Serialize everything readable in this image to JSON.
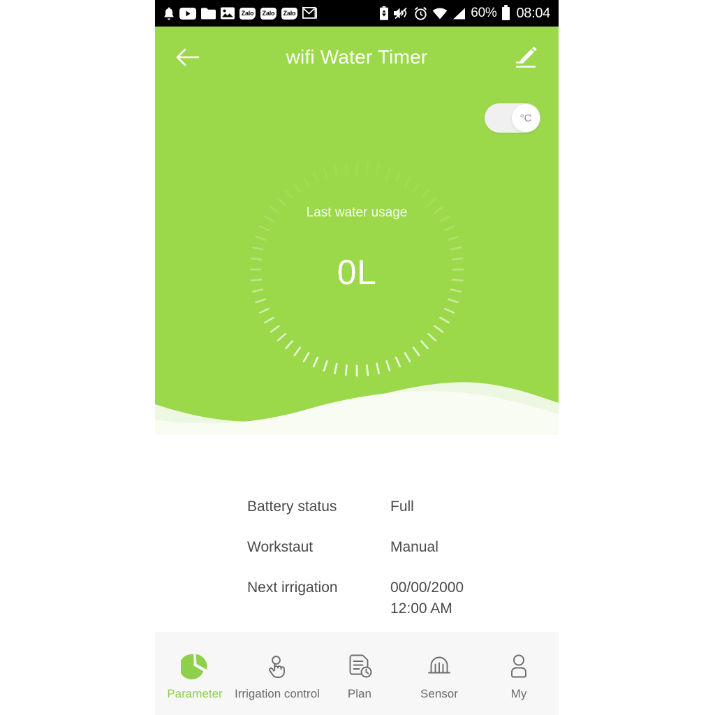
{
  "theme": {
    "green": "#9bd94b",
    "green_accent": "#8ed04a",
    "nav_bg": "#f7f7f7",
    "text_gray": "#4a4a4a",
    "nav_text": "#6b6b6b"
  },
  "status_bar": {
    "left_icons": [
      {
        "name": "notification-bell-icon",
        "glyph": "bell"
      },
      {
        "name": "youtube-icon",
        "glyph": "youtube"
      },
      {
        "name": "folder-icon",
        "glyph": "folder"
      },
      {
        "name": "image-icon",
        "glyph": "image"
      },
      {
        "name": "zalo-icon-1",
        "glyph": "zalo",
        "label": "Zalo"
      },
      {
        "name": "zalo-icon-2",
        "glyph": "zalo",
        "label": "Zalo"
      },
      {
        "name": "zalo-icon-3",
        "glyph": "zalo",
        "label": "Zalo"
      },
      {
        "name": "email-icon",
        "glyph": "envelope"
      }
    ],
    "right_icons": [
      {
        "name": "battery-saver-icon",
        "glyph": "battery-saver"
      },
      {
        "name": "mute-vibrate-icon",
        "glyph": "mute-vibrate"
      },
      {
        "name": "alarm-icon",
        "glyph": "alarm"
      },
      {
        "name": "wifi-icon",
        "glyph": "wifi"
      },
      {
        "name": "cellular-signal-icon",
        "glyph": "signal"
      }
    ],
    "battery_percent": "60%",
    "clock": "08:04"
  },
  "appbar": {
    "title": "wifi Water Timer",
    "back_icon": "arrow-left-icon",
    "edit_icon": "edit-pencil-icon"
  },
  "unit_toggle": {
    "value": "°C",
    "state": "on"
  },
  "dial": {
    "label": "Last water usage",
    "value": "0L",
    "tick_count": 60
  },
  "info": {
    "rows": [
      {
        "label": "Battery status",
        "value": "Full"
      },
      {
        "label": "Workstaut",
        "value": "Manual"
      },
      {
        "label": "Next  irrigation",
        "value": "00/00/2000\n12:00 AM"
      }
    ]
  },
  "bottom_nav": {
    "items": [
      {
        "label": "Parameter",
        "icon": "pie-chart-icon",
        "active": true
      },
      {
        "label": "Irrigation control",
        "icon": "tap-hand-icon",
        "active": false
      },
      {
        "label": "Plan",
        "icon": "document-clock-icon",
        "active": false
      },
      {
        "label": "Sensor",
        "icon": "sensor-dome-icon",
        "active": false
      },
      {
        "label": "My",
        "icon": "person-icon",
        "active": false
      }
    ]
  }
}
